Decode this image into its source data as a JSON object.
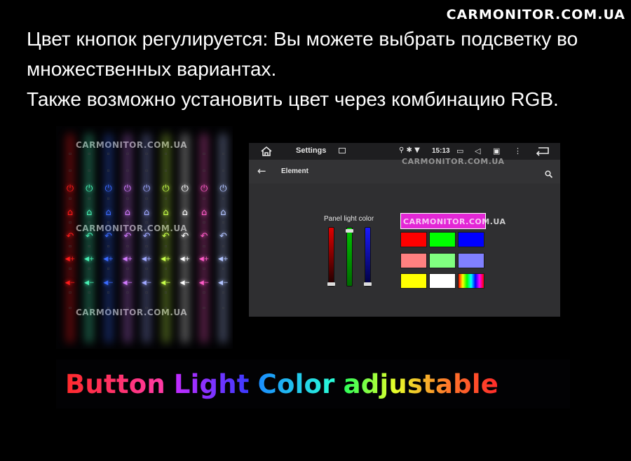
{
  "brand": {
    "site": "CARMONITOR.COM.UA"
  },
  "intro": {
    "line1": "Цвет кнопок регулируется: Вы можете выбрать подсветку во",
    "line2": "множественных вариантах.",
    "line3": "Также возможно установить цвет через комбинацию RGB."
  },
  "button_panel": {
    "watermark": "CARMONITOR.COM.UA",
    "columns": [
      {
        "color": "#ff1a1a"
      },
      {
        "color": "#48f0b4"
      },
      {
        "color": "#3a6bff"
      },
      {
        "color": "#d27bff"
      },
      {
        "color": "#9fa8ff"
      },
      {
        "color": "#c8ff4a"
      },
      {
        "color": "#ffffff"
      },
      {
        "color": "#ff5cc8"
      },
      {
        "color": "#b2c4ff"
      }
    ],
    "icons": [
      "power-icon",
      "home-icon",
      "back-icon",
      "volume-up-icon",
      "volume-down-icon"
    ]
  },
  "screen": {
    "status_bar": {
      "title": "Settings",
      "time": "15:13",
      "icons": [
        "home-icon",
        "image-icon",
        "location-icon",
        "bluetooth-icon",
        "wifi-icon",
        "cast-icon",
        "volume-icon",
        "screenshot-icon",
        "more-vert-icon",
        "return-icon"
      ]
    },
    "toolbar": {
      "title": "Element"
    },
    "watermark": "CARMONITOR.COM.UA",
    "panel_light_label": "Panel light color",
    "sliders": [
      {
        "channel": "red",
        "color": "#e00000",
        "value": 0.03
      },
      {
        "channel": "green",
        "color": "#00c400",
        "value": 0.98
      },
      {
        "channel": "blue",
        "color": "#1a1aff",
        "value": 0.03
      }
    ],
    "preview": {
      "color": "#e327d6",
      "watermark": "CARMONITOR.COM.UA"
    },
    "swatches": [
      [
        "#ff0000",
        "#00ff00",
        "#0000ff"
      ],
      [
        "#ff8080",
        "#80ff80",
        "#8080ff"
      ],
      [
        "#ffff00",
        "#ffffff",
        "rainbow"
      ]
    ]
  },
  "headline": {
    "words": [
      {
        "text": "Button",
        "color": "#ff2a2a"
      },
      {
        "text": "Light",
        "color": "#8a2be2"
      },
      {
        "text": "Color",
        "color": "#1fc8ff"
      },
      {
        "text": "adjustable",
        "color": "#3dff3d"
      }
    ]
  }
}
